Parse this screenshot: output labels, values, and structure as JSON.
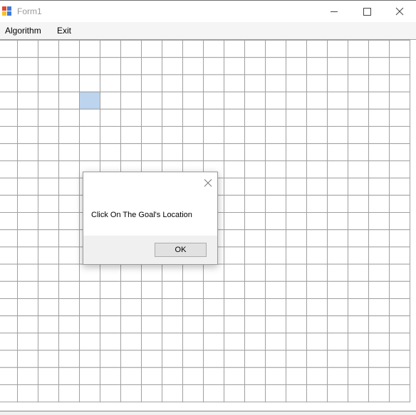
{
  "window": {
    "title": "Form1"
  },
  "menu": {
    "items": [
      "Algorithm",
      "Exit"
    ]
  },
  "grid": {
    "columns": 20,
    "rows": 21,
    "highlight_cell": {
      "col": 4,
      "row": 3
    },
    "highlight_color": "#bcd4ee",
    "line_color": "#a0a0a0"
  },
  "dialog": {
    "message": "Click On The Goal's Location",
    "ok_label": "OK"
  },
  "icons": [
    "app-icon",
    "minimize-icon",
    "maximize-icon",
    "close-icon",
    "dialog-close-icon"
  ]
}
